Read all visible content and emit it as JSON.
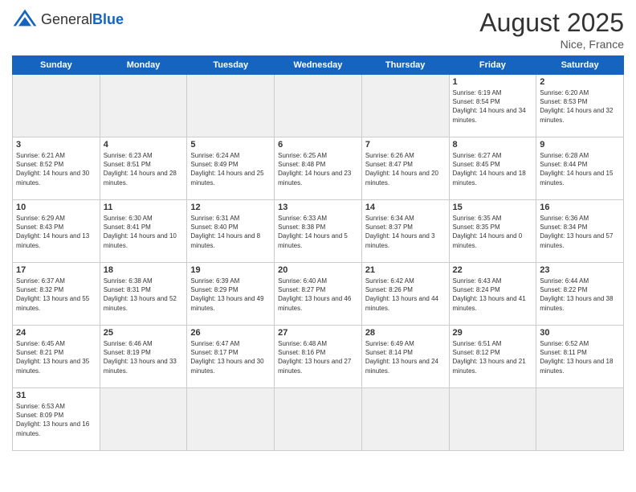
{
  "header": {
    "logo_general": "General",
    "logo_blue": "Blue",
    "month_year": "August 2025",
    "location": "Nice, France"
  },
  "weekdays": [
    "Sunday",
    "Monday",
    "Tuesday",
    "Wednesday",
    "Thursday",
    "Friday",
    "Saturday"
  ],
  "weeks": [
    [
      {
        "day": "",
        "empty": true
      },
      {
        "day": "",
        "empty": true
      },
      {
        "day": "",
        "empty": true
      },
      {
        "day": "",
        "empty": true
      },
      {
        "day": "",
        "empty": true
      },
      {
        "day": "1",
        "sunrise": "6:19 AM",
        "sunset": "8:54 PM",
        "daylight": "14 hours and 34 minutes."
      },
      {
        "day": "2",
        "sunrise": "6:20 AM",
        "sunset": "8:53 PM",
        "daylight": "14 hours and 32 minutes."
      }
    ],
    [
      {
        "day": "3",
        "sunrise": "6:21 AM",
        "sunset": "8:52 PM",
        "daylight": "14 hours and 30 minutes."
      },
      {
        "day": "4",
        "sunrise": "6:23 AM",
        "sunset": "8:51 PM",
        "daylight": "14 hours and 28 minutes."
      },
      {
        "day": "5",
        "sunrise": "6:24 AM",
        "sunset": "8:49 PM",
        "daylight": "14 hours and 25 minutes."
      },
      {
        "day": "6",
        "sunrise": "6:25 AM",
        "sunset": "8:48 PM",
        "daylight": "14 hours and 23 minutes."
      },
      {
        "day": "7",
        "sunrise": "6:26 AM",
        "sunset": "8:47 PM",
        "daylight": "14 hours and 20 minutes."
      },
      {
        "day": "8",
        "sunrise": "6:27 AM",
        "sunset": "8:45 PM",
        "daylight": "14 hours and 18 minutes."
      },
      {
        "day": "9",
        "sunrise": "6:28 AM",
        "sunset": "8:44 PM",
        "daylight": "14 hours and 15 minutes."
      }
    ],
    [
      {
        "day": "10",
        "sunrise": "6:29 AM",
        "sunset": "8:43 PM",
        "daylight": "14 hours and 13 minutes."
      },
      {
        "day": "11",
        "sunrise": "6:30 AM",
        "sunset": "8:41 PM",
        "daylight": "14 hours and 10 minutes."
      },
      {
        "day": "12",
        "sunrise": "6:31 AM",
        "sunset": "8:40 PM",
        "daylight": "14 hours and 8 minutes."
      },
      {
        "day": "13",
        "sunrise": "6:33 AM",
        "sunset": "8:38 PM",
        "daylight": "14 hours and 5 minutes."
      },
      {
        "day": "14",
        "sunrise": "6:34 AM",
        "sunset": "8:37 PM",
        "daylight": "14 hours and 3 minutes."
      },
      {
        "day": "15",
        "sunrise": "6:35 AM",
        "sunset": "8:35 PM",
        "daylight": "14 hours and 0 minutes."
      },
      {
        "day": "16",
        "sunrise": "6:36 AM",
        "sunset": "8:34 PM",
        "daylight": "13 hours and 57 minutes."
      }
    ],
    [
      {
        "day": "17",
        "sunrise": "6:37 AM",
        "sunset": "8:32 PM",
        "daylight": "13 hours and 55 minutes."
      },
      {
        "day": "18",
        "sunrise": "6:38 AM",
        "sunset": "8:31 PM",
        "daylight": "13 hours and 52 minutes."
      },
      {
        "day": "19",
        "sunrise": "6:39 AM",
        "sunset": "8:29 PM",
        "daylight": "13 hours and 49 minutes."
      },
      {
        "day": "20",
        "sunrise": "6:40 AM",
        "sunset": "8:27 PM",
        "daylight": "13 hours and 46 minutes."
      },
      {
        "day": "21",
        "sunrise": "6:42 AM",
        "sunset": "8:26 PM",
        "daylight": "13 hours and 44 minutes."
      },
      {
        "day": "22",
        "sunrise": "6:43 AM",
        "sunset": "8:24 PM",
        "daylight": "13 hours and 41 minutes."
      },
      {
        "day": "23",
        "sunrise": "6:44 AM",
        "sunset": "8:22 PM",
        "daylight": "13 hours and 38 minutes."
      }
    ],
    [
      {
        "day": "24",
        "sunrise": "6:45 AM",
        "sunset": "8:21 PM",
        "daylight": "13 hours and 35 minutes."
      },
      {
        "day": "25",
        "sunrise": "6:46 AM",
        "sunset": "8:19 PM",
        "daylight": "13 hours and 33 minutes."
      },
      {
        "day": "26",
        "sunrise": "6:47 AM",
        "sunset": "8:17 PM",
        "daylight": "13 hours and 30 minutes."
      },
      {
        "day": "27",
        "sunrise": "6:48 AM",
        "sunset": "8:16 PM",
        "daylight": "13 hours and 27 minutes."
      },
      {
        "day": "28",
        "sunrise": "6:49 AM",
        "sunset": "8:14 PM",
        "daylight": "13 hours and 24 minutes."
      },
      {
        "day": "29",
        "sunrise": "6:51 AM",
        "sunset": "8:12 PM",
        "daylight": "13 hours and 21 minutes."
      },
      {
        "day": "30",
        "sunrise": "6:52 AM",
        "sunset": "8:11 PM",
        "daylight": "13 hours and 18 minutes."
      }
    ],
    [
      {
        "day": "31",
        "sunrise": "6:53 AM",
        "sunset": "8:09 PM",
        "daylight": "13 hours and 16 minutes."
      },
      {
        "day": "",
        "empty": true
      },
      {
        "day": "",
        "empty": true
      },
      {
        "day": "",
        "empty": true
      },
      {
        "day": "",
        "empty": true
      },
      {
        "day": "",
        "empty": true
      },
      {
        "day": "",
        "empty": true
      }
    ]
  ]
}
